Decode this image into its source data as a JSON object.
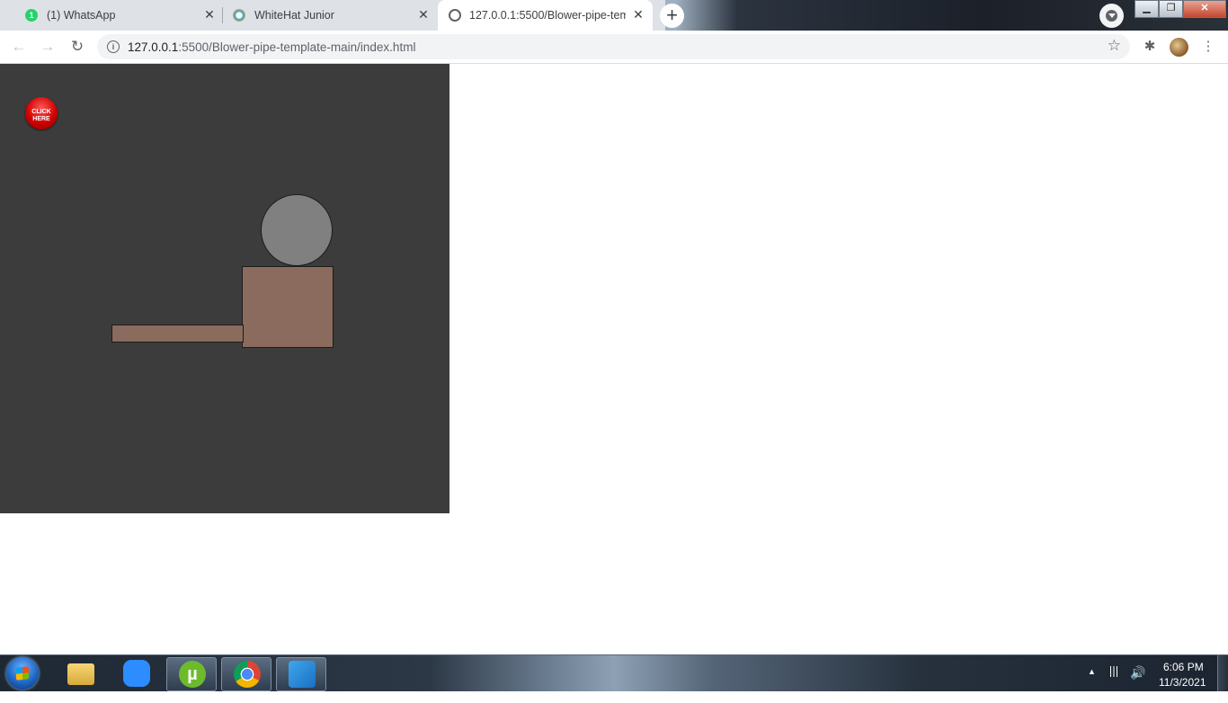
{
  "browser": {
    "tabs": [
      {
        "title": "(1) WhatsApp",
        "favicon": "whatsapp-icon",
        "badge": "1",
        "active": false
      },
      {
        "title": "WhiteHat Junior",
        "favicon": "whitehat-jr-icon",
        "active": false
      },
      {
        "title": "127.0.0.1:5500/Blower-pipe-temp",
        "favicon": "globe-icon",
        "active": true
      }
    ],
    "new_tab_label": "+",
    "close_glyph": "✕",
    "url_host": "127.0.0.1",
    "url_rest": ":5500/Blower-pipe-template-main/index.html",
    "info_glyph": "i",
    "star_glyph": "☆",
    "nav": {
      "back": "←",
      "forward": "→",
      "reload": "↻"
    },
    "extensions_glyph": "✱",
    "menu_glyph": "⋮",
    "window_controls": {
      "minimize": "▁",
      "maximize": "❐",
      "close": "✕"
    }
  },
  "page": {
    "click_button_text": "CLICK HERE",
    "colors": {
      "canvas": "#3c3c3c",
      "ball": "#808080",
      "blower_body": "#8b6b5d",
      "click_button": "#d00000"
    }
  },
  "taskbar": {
    "apps": [
      {
        "name": "file-explorer",
        "icon": "folder-icon"
      },
      {
        "name": "zoom",
        "icon": "zoom-icon"
      },
      {
        "name": "utorrent",
        "icon": "utorrent-icon",
        "glyph": "µ"
      },
      {
        "name": "chrome",
        "icon": "chrome-icon"
      },
      {
        "name": "vscode",
        "icon": "vscode-icon"
      }
    ],
    "tray_up_glyph": "▲",
    "time": "6:06 PM",
    "date": "11/3/2021"
  }
}
